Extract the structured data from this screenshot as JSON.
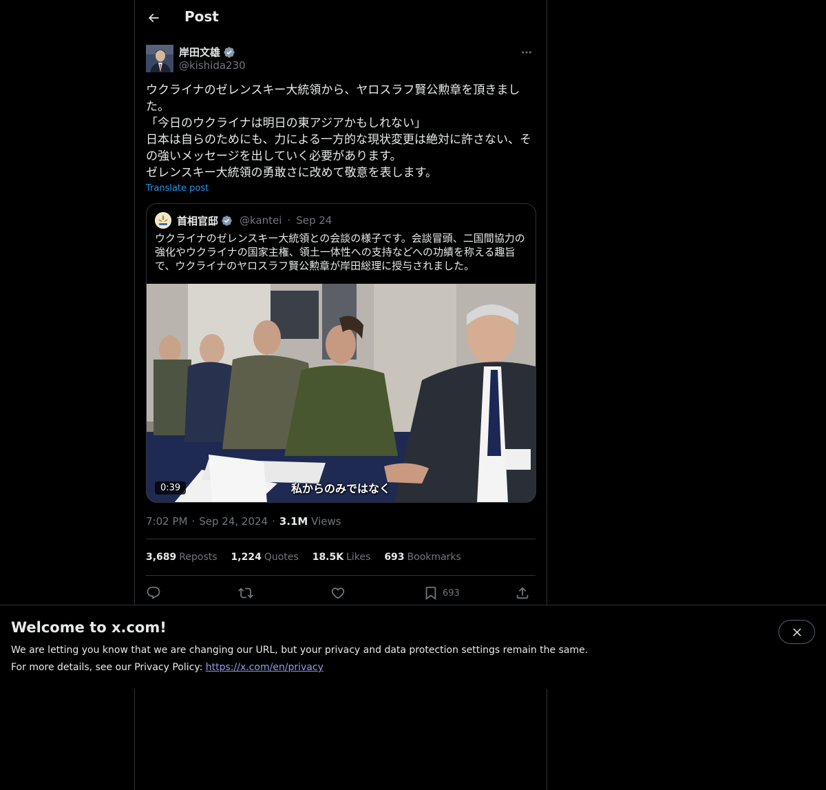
{
  "header": {
    "title": "Post"
  },
  "author": {
    "name": "岸田文雄",
    "handle": "@kishida230"
  },
  "post": {
    "lines": [
      "ウクライナのゼレンスキー大統領から、ヤロスラフ賢公勲章を頂きまし",
      "た。",
      "「今日のウクライナは明日の東アジアかもしれない」",
      "日本は自らのためにも、力による一方的な現状変更は絶対に許さない、そ",
      "の強いメッセージを出していく必要があります。",
      "ゼレンスキー大統領の勇敢さに改めて敬意を表します。"
    ],
    "translate_label": "Translate post"
  },
  "quote": {
    "name": "首相官邸",
    "handle": "@kantei",
    "dot": "·",
    "date": "Sep 24",
    "lines": [
      "ウクライナのゼレンスキー大統領との会談の様子です。会談冒頭、二国間協力の",
      "強化やウクライナの国家主権、領土一体性への支持などへの功績を称える趣旨",
      "で、ウクライナのヤロスラフ賢公勲章が岸田総理に授与されました。"
    ],
    "video": {
      "duration": "0:39",
      "subtitle": "私からのみではなく"
    }
  },
  "meta": {
    "time": "7:02 PM",
    "sep": "·",
    "date": "Sep 24, 2024",
    "views_count": "3.1M",
    "views_label": "Views"
  },
  "stats": {
    "reposts_count": "3,689",
    "reposts_label": "Reposts",
    "quotes_count": "1,224",
    "quotes_label": "Quotes",
    "likes_count": "18.5K",
    "likes_label": "Likes",
    "bookmarks_count": "693",
    "bookmarks_label": "Bookmarks"
  },
  "actions": {
    "bookmark_count": "693"
  },
  "banner": {
    "title": "Welcome to x.com!",
    "line1": "We are letting you know that we are changing our URL, but your privacy and data protection settings remain the same.",
    "line2": "For more details, see our Privacy Policy:",
    "link": "https://x.com/en/privacy"
  },
  "colors": {
    "accent": "#1d9bf0",
    "background": "#000000",
    "border": "#2f3336",
    "muted": "#71767b",
    "verified": "#829aab"
  }
}
